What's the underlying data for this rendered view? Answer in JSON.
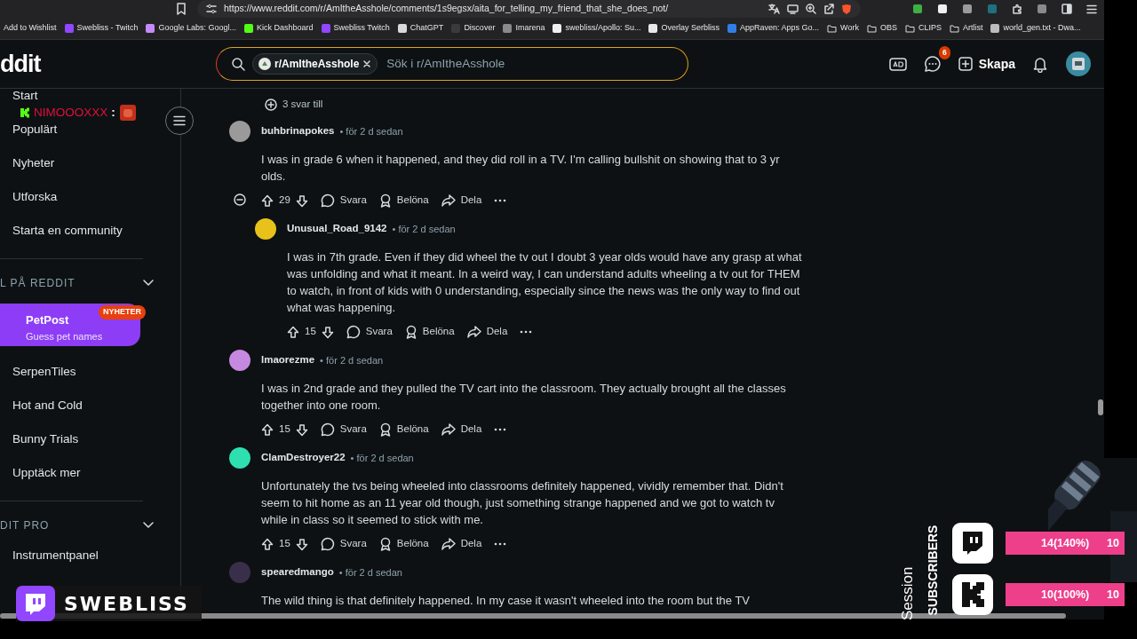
{
  "browser": {
    "url": "https://www.reddit.com/r/AmItheAsshole/comments/1s9egsx/aita_for_telling_my_friend_that_she_does_not/",
    "bookmarks": [
      {
        "label": "Add to Wishlist",
        "kind": "plain"
      },
      {
        "label": "Swebliss - Twitch",
        "kind": "site",
        "color": "#9146ff"
      },
      {
        "label": "Google Labs: Googl...",
        "kind": "site",
        "color": "#c58af9"
      },
      {
        "label": "Kick Dashboard",
        "kind": "site",
        "color": "#53fc18"
      },
      {
        "label": "Swebliss Twitch",
        "kind": "site",
        "color": "#9146ff"
      },
      {
        "label": "ChatGPT",
        "kind": "site",
        "color": "#d9d9d9"
      },
      {
        "label": "Discover",
        "kind": "site",
        "color": "#3a3a3a"
      },
      {
        "label": "Imarena",
        "kind": "site",
        "color": "#8a8a8a"
      },
      {
        "label": "swebliss/Apollo: Su...",
        "kind": "site",
        "color": "#f0f0f0"
      },
      {
        "label": "Overlay Serbliss",
        "kind": "site",
        "color": "#e8e8e8"
      },
      {
        "label": "AppRaven: Apps Go...",
        "kind": "site",
        "color": "#2f7fe6"
      },
      {
        "label": "Work",
        "kind": "folder"
      },
      {
        "label": "OBS",
        "kind": "folder"
      },
      {
        "label": "CLIPS",
        "kind": "folder"
      },
      {
        "label": "Artlist",
        "kind": "folder"
      },
      {
        "label": "world_gen.txt - Dwa...",
        "kind": "site",
        "color": "#bbbbbb"
      }
    ]
  },
  "header": {
    "logo": "ddit",
    "search_chip": "r/AmItheAsshole",
    "search": {
      "placeholder": "Sök i r/AmItheAsshole"
    },
    "chat_badge": "6",
    "create": "Skapa"
  },
  "sidebar": {
    "nav": [
      "Start",
      "Populärt",
      "Nyheter",
      "Utforska",
      "Starta en community"
    ],
    "games_heading": "L PÅ REDDIT",
    "featured_game": {
      "title": "PetPost",
      "subtitle": "Guess pet names",
      "badge": "NYHETER"
    },
    "games": [
      {
        "label": "SerpenTiles"
      },
      {
        "label": "Hot and Cold"
      },
      {
        "label": "Bunny Trials"
      },
      {
        "label": "Upptäck mer"
      }
    ],
    "pro_heading": "DIT PRO",
    "pro_items": [
      "Instrumentpanel"
    ]
  },
  "thread": {
    "more_replies": "3 svar till",
    "comments": [
      {
        "user": "buhbrinapokes",
        "time": "• för 2 d sedan",
        "color": "#9a9a9a",
        "text": "I was in grade 6 when it happened, and they did roll in a TV. I'm calling bullshit on showing that to 3 yr olds.",
        "votes": "29",
        "actions": [
          "Svara",
          "Belöna",
          "Dela"
        ],
        "expanded": true,
        "children": [
          {
            "user": "Unusual_Road_9142",
            "time": "• för 2 d sedan",
            "color": "#e8c21a",
            "text": "I was in 7th grade. Even if they did wheel the tv out I doubt 3 year olds would have any grasp at what was unfolding and what it meant. In a weird way, I can understand adults wheeling a tv out for THEM to watch, in front of kids with 0 understanding, especially since the news was the only way to find out what was happening.",
            "votes": "15",
            "actions": [
              "Svara",
              "Belöna",
              "Dela"
            ]
          }
        ]
      },
      {
        "user": "lmaorezme",
        "time": "• för 2 d sedan",
        "color": "#c58ae0",
        "text": "I was in 2nd grade and they pulled the TV cart into the classroom. They actually brought all the classes together into one room.",
        "votes": "15",
        "actions": [
          "Svara",
          "Belöna",
          "Dela"
        ]
      },
      {
        "user": "ClamDestroyer22",
        "time": "• för 2 d sedan",
        "color": "#2ee0b0",
        "text": "Unfortunately the tvs being wheeled into classrooms definitely happened, vividly remember that. Didn't seem to hit home as an 11 year old though, just something strange happened and we got to watch tv while in class so it seemed to stick with me.",
        "votes": "15",
        "actions": [
          "Svara",
          "Belöna",
          "Dela"
        ]
      },
      {
        "user": "spearedmango",
        "time": "• för 2 d sedan",
        "color": "#3a2f4a",
        "text": "The wild thing is that definitely happened. In my case it wasn't wheeled into the room but the TV"
      }
    ]
  },
  "chat_overlay": {
    "user": "NIMOOOXXX",
    "separator": ":"
  },
  "stream_overlay": {
    "channel": "SWEBLISS",
    "session_label": "Session",
    "goal_label": "SUBSCRIBERS",
    "goals": [
      {
        "kind": "twitch",
        "count": "14(140%)",
        "target": "10",
        "level": 1
      },
      {
        "kind": "kick",
        "count": "10(100%)",
        "target": "10",
        "level": 1
      }
    ]
  }
}
